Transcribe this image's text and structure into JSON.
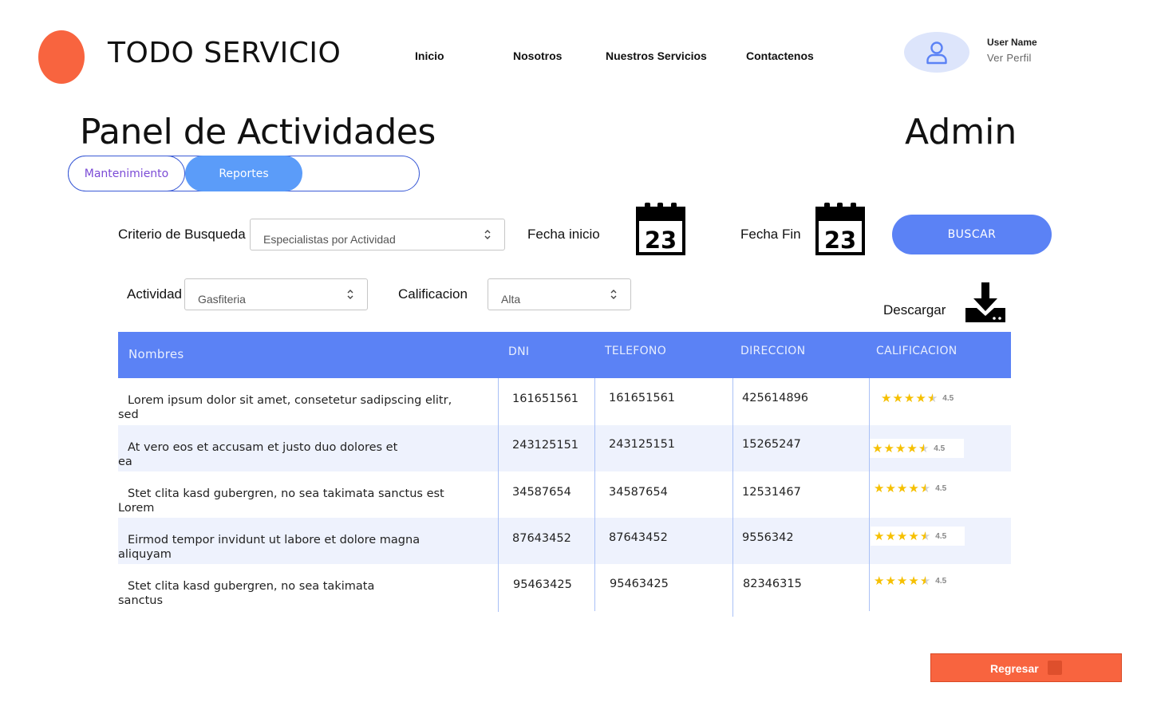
{
  "brand": {
    "name": "TODO SERVICIO",
    "logo_color": "#f8643f"
  },
  "nav": [
    {
      "label": "Inicio"
    },
    {
      "label": "Nosotros"
    },
    {
      "label": "Nuestros Servicios"
    },
    {
      "label": "Contactenos"
    }
  ],
  "user": {
    "name": "User Name",
    "profile_link": "Ver Perfil",
    "icon": "user-icon"
  },
  "page": {
    "title": "Panel de Actividades",
    "role": "Admin"
  },
  "tabs": [
    {
      "label": "Mantenimiento",
      "active": false
    },
    {
      "label": "Reportes",
      "active": true
    }
  ],
  "filters": {
    "criterio_label": "Criterio de Busqueda",
    "criterio_value": "Especialistas por Actividad",
    "fecha_inicio_label": "Fecha inicio",
    "fecha_fin_label": "Fecha Fin",
    "calendar_day": "23",
    "buscar_label": "BUSCAR",
    "actividad_label": "Actividad",
    "actividad_value": "Gasfiteria",
    "calificacion_label": "Calificacion",
    "calificacion_value": "Alta",
    "descargar_label": "Descargar"
  },
  "table": {
    "headers": [
      "Nombres",
      "DNI",
      "TELEFONO",
      "DIRECCION",
      "CALIFICACION"
    ],
    "rows": [
      {
        "name_line1": "Lorem ipsum dolor sit amet, consetetur sadipscing elitr,",
        "name_line2": "sed",
        "dni": "161651561",
        "telefono": "161651561",
        "direccion": "425614896",
        "rating": "4.5",
        "rating_value": 4.5
      },
      {
        "name_line1": "At vero eos et accusam et justo duo dolores et",
        "name_line2": "ea",
        "dni": "243125151",
        "telefono": "243125151",
        "direccion": "15265247",
        "rating": "4.5",
        "rating_value": 4.5
      },
      {
        "name_line1": "Stet clita kasd gubergren, no sea takimata sanctus est",
        "name_line2": "Lorem",
        "dni": "34587654",
        "telefono": "34587654",
        "direccion": "12531467",
        "rating": "4.5",
        "rating_value": 4.5
      },
      {
        "name_line1": "Eirmod tempor invidunt ut labore et dolore magna",
        "name_line2": "aliquyam",
        "dni": "87643452",
        "telefono": "87643452",
        "direccion": "9556342",
        "rating": "4.5",
        "rating_value": 4.5
      },
      {
        "name_line1": "Stet clita kasd gubergren, no sea takimata",
        "name_line2": "sanctus",
        "dni": "95463425",
        "telefono": "95463425",
        "direccion": "82346315",
        "rating": "4.5",
        "rating_value": 4.5
      }
    ]
  },
  "footer": {
    "regresar_label": "Regresar"
  },
  "colors": {
    "accent": "#5b82f5",
    "tab_active": "#5b9cf9",
    "brand_orange": "#f8643f",
    "row_alt": "#eef2fd",
    "star": "#f6c000"
  }
}
